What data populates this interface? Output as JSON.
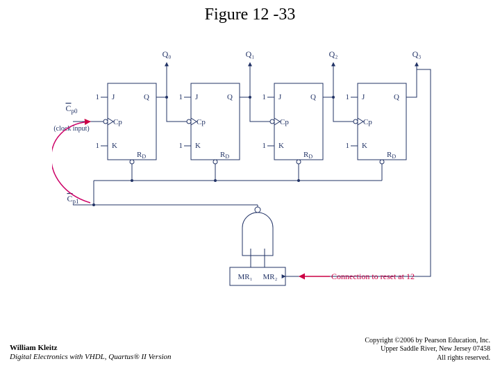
{
  "title": "Figure 12 -33",
  "circuit": {
    "q_outputs": [
      "Q₀",
      "Q₁",
      "Q₂",
      "Q₃"
    ],
    "pin_labels": {
      "J": "1",
      "K": "1",
      "Jname": "J",
      "Kname": "K",
      "Cp": "Cp",
      "Q": "Q",
      "Rd": "R_D"
    },
    "clock_label_prefix": "C",
    "clock_label_sub0": "p0",
    "clock_label_note": "(clock input)",
    "clock_label_sub1": "p1",
    "nand_inputs": [
      "MR₁",
      "MR₂"
    ],
    "reset_note": "Connection to reset at 12"
  },
  "footer": {
    "author": "William Kleitz",
    "book": "Digital Electronics with VHDL, Quartus® II Version",
    "copyright": "Copyright ©2006 by Pearson Education, Inc.",
    "address": "Upper Saddle River, New Jersey 07458",
    "rights": "All rights reserved."
  }
}
